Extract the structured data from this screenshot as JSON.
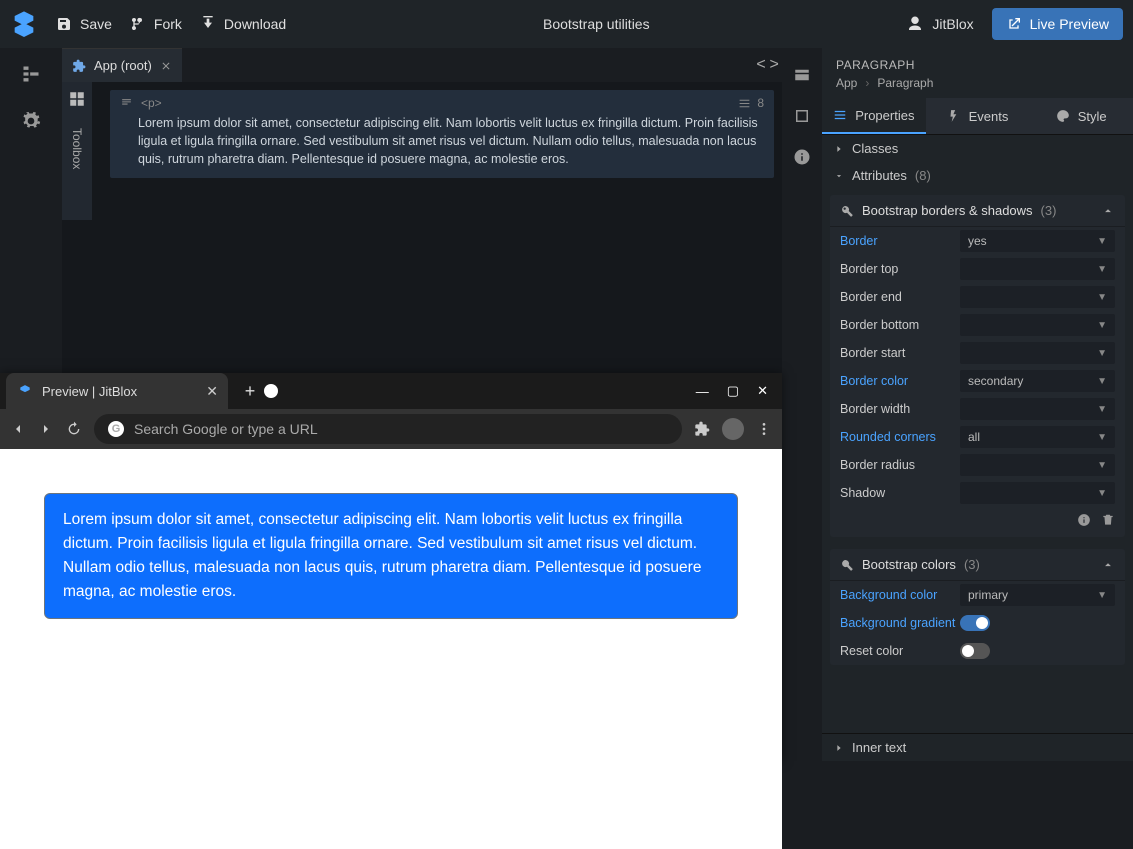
{
  "header": {
    "save": "Save",
    "fork": "Fork",
    "download": "Download",
    "title": "Bootstrap utilities",
    "user": "JitBlox",
    "live_preview": "Live Preview"
  },
  "tab": {
    "label": "App (root)"
  },
  "toolbox": {
    "label": "Toolbox"
  },
  "code": {
    "tag": "<p>",
    "count": "8",
    "text": "Lorem ipsum dolor sit amet, consectetur adipiscing elit. Nam lobortis velit luctus ex fringilla dictum. Proin facilisis ligula et ligula fringilla ornare. Sed vestibulum sit amet risus vel dictum. Nullam odio tellus, malesuada non lacus quis, rutrum pharetra diam. Pellentesque id posuere magna, ac molestie eros."
  },
  "browser": {
    "tab_title": "Preview | JitBlox",
    "address_placeholder": "Search Google or type a URL",
    "g_letter": "G",
    "paragraph": "Lorem ipsum dolor sit amet, consectetur adipiscing elit. Nam lobortis velit luctus ex fringilla dictum. Proin facilisis ligula et ligula fringilla ornare. Sed vestibulum sit amet risus vel dictum. Nullam odio tellus, malesuada non lacus quis, rutrum pharetra diam. Pellentesque id posuere magna, ac molestie eros."
  },
  "panel": {
    "title": "PARAGRAPH",
    "breadcrumb": {
      "root": "App",
      "current": "Paragraph"
    },
    "tabs": {
      "properties": "Properties",
      "events": "Events",
      "style": "Style"
    },
    "sections": {
      "classes": "Classes",
      "attributes": "Attributes",
      "attributes_count": "(8)",
      "inner_text": "Inner text"
    },
    "group_borders": {
      "title": "Bootstrap borders & shadows",
      "count": "(3)",
      "props": {
        "border": {
          "label": "Border",
          "value": "yes",
          "blue": true
        },
        "border_top": {
          "label": "Border top",
          "value": ""
        },
        "border_end": {
          "label": "Border end",
          "value": ""
        },
        "border_bottom": {
          "label": "Border bottom",
          "value": ""
        },
        "border_start": {
          "label": "Border start",
          "value": ""
        },
        "border_color": {
          "label": "Border color",
          "value": "secondary",
          "blue": true
        },
        "border_width": {
          "label": "Border width",
          "value": ""
        },
        "rounded": {
          "label": "Rounded corners",
          "value": "all",
          "blue": true
        },
        "border_radius": {
          "label": "Border radius",
          "value": ""
        },
        "shadow": {
          "label": "Shadow",
          "value": ""
        }
      }
    },
    "group_colors": {
      "title": "Bootstrap colors",
      "count": "(3)",
      "props": {
        "bg_color": {
          "label": "Background color",
          "value": "primary",
          "blue": true
        },
        "bg_gradient": {
          "label": "Background gradient",
          "blue": true
        },
        "reset_color": {
          "label": "Reset color"
        }
      }
    }
  }
}
